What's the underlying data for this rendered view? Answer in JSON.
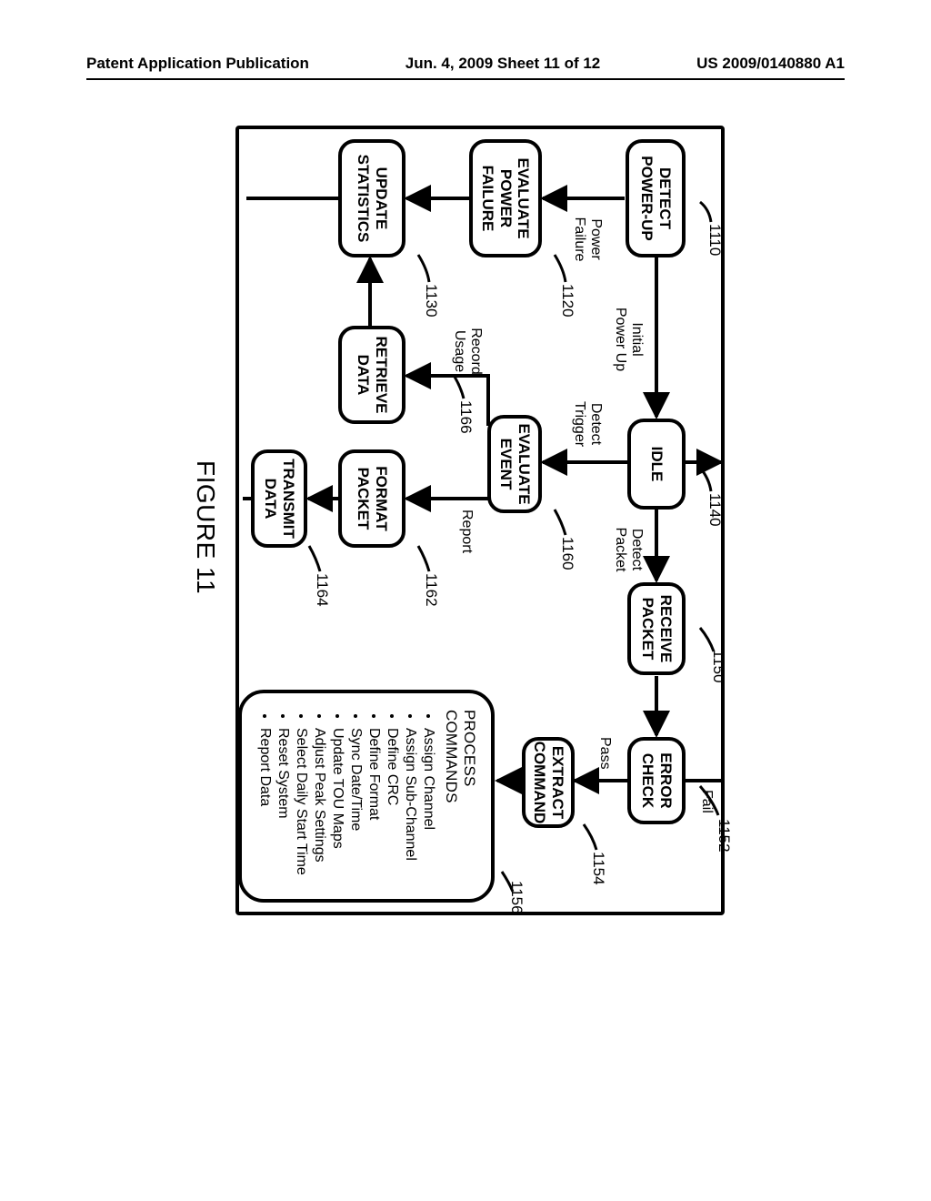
{
  "header": {
    "left": "Patent Application Publication",
    "center": "Jun. 4, 2009  Sheet 11 of 12",
    "right": "US 2009/0140880 A1"
  },
  "figure": {
    "caption": "FIGURE 11"
  },
  "refs": {
    "n1110": "1110",
    "n1120": "1120",
    "n1130": "1130",
    "n1140": "1140",
    "n1150": "1150",
    "n1152": "1152",
    "n1154": "1154",
    "n1156": "1156",
    "n1160": "1160",
    "n1162": "1162",
    "n1164": "1164",
    "n1166": "1166"
  },
  "nodes": {
    "detect_powerup": "DETECT\nPOWER-UP",
    "evaluate_power_failure": "EVALUATE\nPOWER\nFAILURE",
    "update_statistics": "UPDATE\nSTATISTICS",
    "idle": "IDLE",
    "evaluate_event": "EVALUATE\nEVENT",
    "format_packet": "FORMAT\nPACKET",
    "transmit_data": "TRANSMIT\nDATA",
    "retrieve_data": "RETRIEVE\nDATA",
    "receive_packet": "RECEIVE\nPACKET",
    "error_check": "ERROR\nCHECK",
    "extract_command": "EXTRACT\nCOMMAND"
  },
  "edges": {
    "power_failure": "Power\nFailure",
    "initial_power_up": "Initial\nPower Up",
    "detect_trigger": "Detect\nTrigger",
    "detect_packet": "Detect\nPacket",
    "record_usage": "Record\nUsage",
    "report": "Report",
    "pass": "Pass",
    "fail": "Fail"
  },
  "commands": {
    "title": "PROCESS COMMANDS",
    "items": [
      "Assign Channel",
      "Assign Sub-Channel",
      "Define CRC",
      "Define Format",
      "Sync Date/Time",
      "Update TOU Maps",
      "Adjust Peak Settings",
      "Select Daily Start Time",
      "Reset System",
      "Report Data"
    ]
  }
}
